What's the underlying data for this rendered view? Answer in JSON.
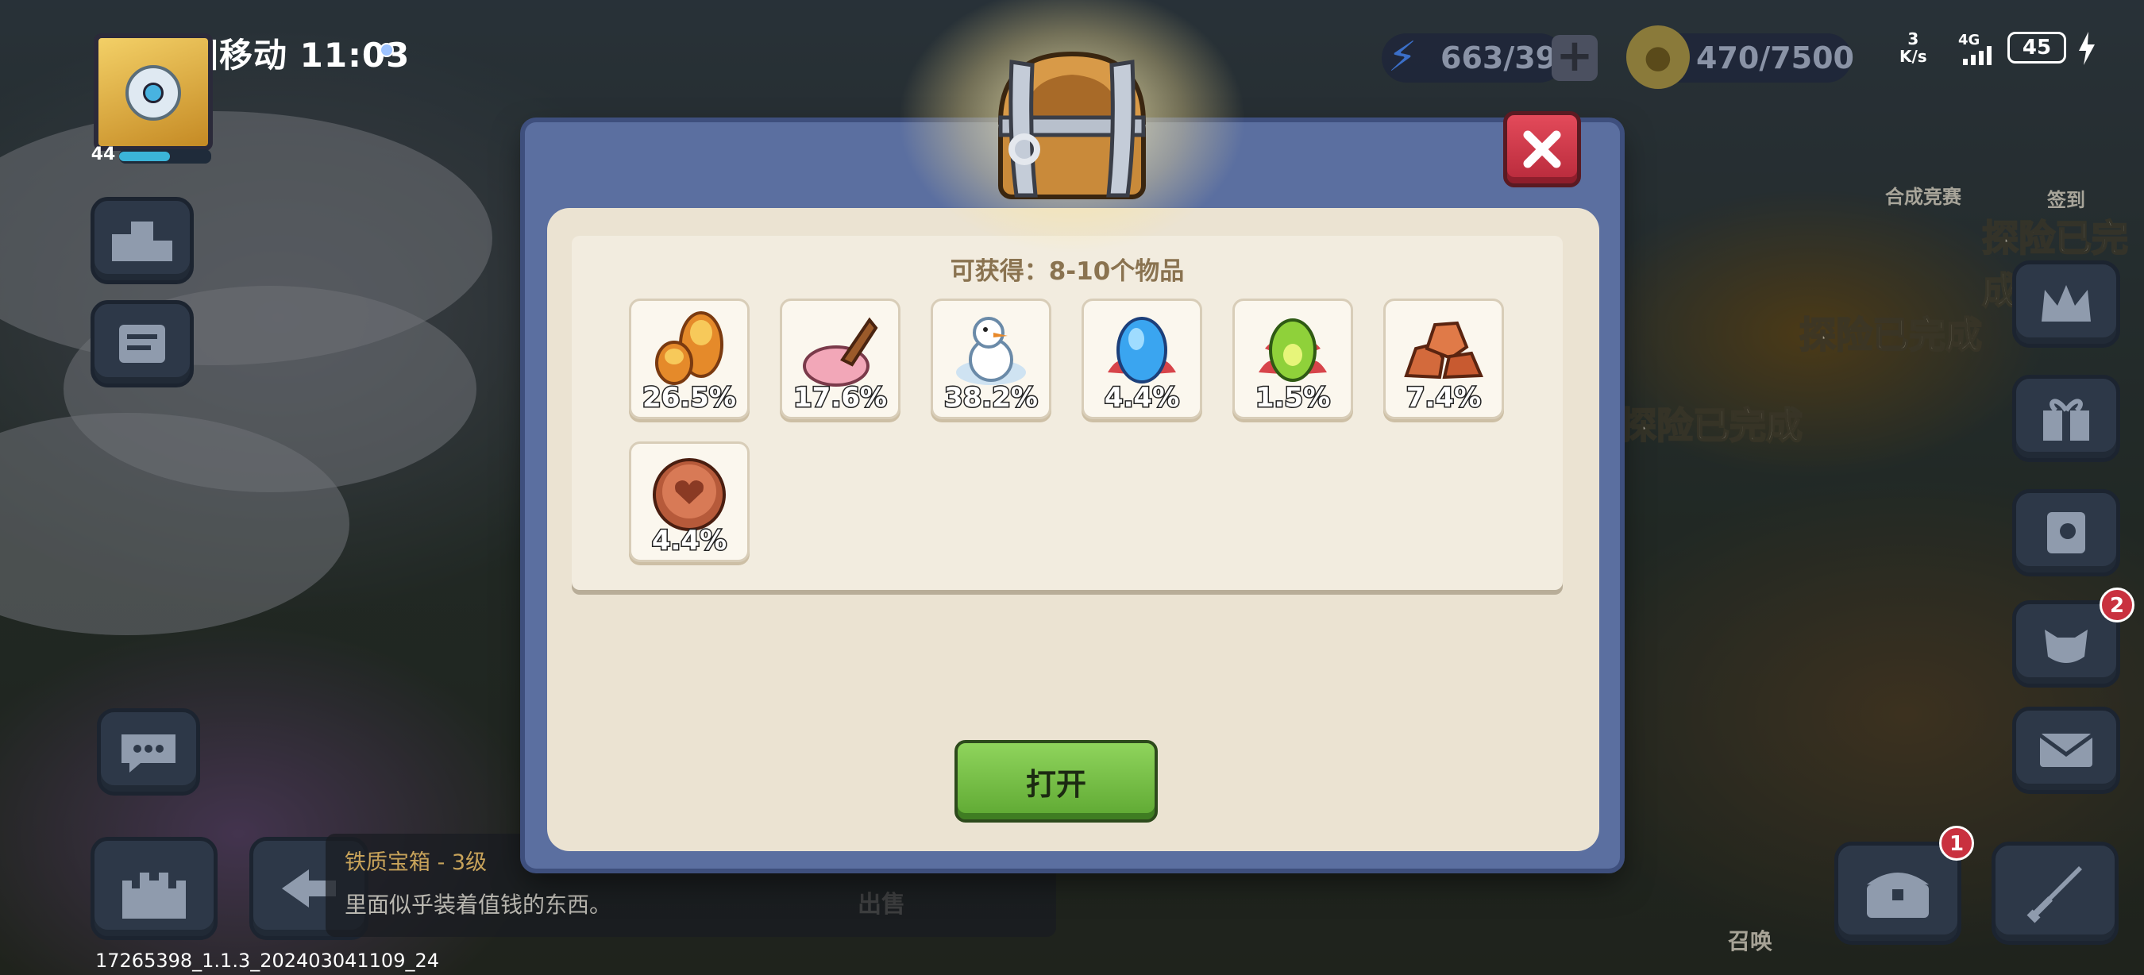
{
  "status_bar": {
    "carrier_time": "中国移动 11:03",
    "net_speed_value": "3",
    "net_speed_unit": "K/s",
    "network": "4G",
    "battery": "45"
  },
  "player": {
    "level": "44",
    "xp_fraction": 0.55
  },
  "resources": {
    "energy": "663/393",
    "coins": "470/7500"
  },
  "scene": {
    "labels": [
      "探险已完成",
      "探险已完成",
      "探险已完成"
    ],
    "contest_label": "合成竞赛",
    "checkin_label": "签到",
    "summon_label": "召唤",
    "sell_label": "出售",
    "badge_envelope": "2",
    "badge_chest": "1"
  },
  "selected_item": {
    "title": "铁质宝箱 - 3级",
    "description": "里面似乎装着值钱的东西。"
  },
  "build_id": "17265398_1.1.3_202403041109_24",
  "modal": {
    "yield_text": "可获得：8-10个物品",
    "open_button": "打开",
    "items": [
      {
        "icon": "orange-crystals-icon",
        "percent": "26.5%"
      },
      {
        "icon": "ice-cream-icon",
        "percent": "17.6%"
      },
      {
        "icon": "snowman-icon",
        "percent": "38.2%"
      },
      {
        "icon": "blue-egg-icon",
        "percent": "4.4%"
      },
      {
        "icon": "green-egg-icon",
        "percent": "1.5%"
      },
      {
        "icon": "copper-ore-icon",
        "percent": "7.4%"
      },
      {
        "icon": "heart-coin-icon",
        "percent": "4.4%"
      }
    ]
  },
  "colors": {
    "modal_frame": "#5b6fa0",
    "paper": "#ebe3d2",
    "open_button": "#6cb83e",
    "close_button": "#d13c4c"
  }
}
